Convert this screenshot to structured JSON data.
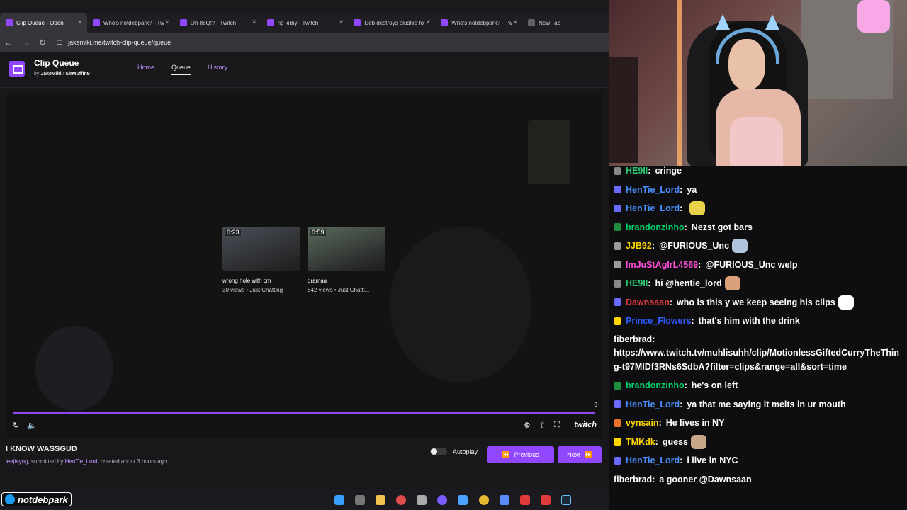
{
  "browser": {
    "tabs": [
      {
        "label": "Clip Queue - Open",
        "active": true,
        "fav_color": "#9147ff"
      },
      {
        "label": "Who's notdebpark? - Tw",
        "active": false,
        "fav_color": "#9147ff"
      },
      {
        "label": "Oh 88Q!? - Twitch",
        "active": false,
        "fav_color": "#9147ff"
      },
      {
        "label": "rip kirby - Twitch",
        "active": false,
        "fav_color": "#9147ff"
      },
      {
        "label": "Deb destroys plushie fo",
        "active": false,
        "fav_color": "#9147ff"
      },
      {
        "label": "Who's notdebpark? - Tw",
        "active": false,
        "fav_color": "#9147ff"
      },
      {
        "label": "New Tab",
        "active": false,
        "fav_color": "#5f6368"
      }
    ],
    "url": "jakemiki.me/twitch-clip-queue/queue"
  },
  "app": {
    "title": "Clip Queue",
    "by": "by",
    "author1": "JakeMiki",
    "sep": "/",
    "author2": "SirMuffin9",
    "nav": [
      {
        "label": "Home",
        "active": false
      },
      {
        "label": "Queue",
        "active": true
      },
      {
        "label": "History",
        "active": false
      }
    ]
  },
  "player": {
    "queue_count": "0",
    "brand": "twitch",
    "progress_fraction": 1.0,
    "clips": [
      {
        "duration": "0:23",
        "title": "wrong hole with cm",
        "meta": "30 views • Just Chatting",
        "thumb_color": "#4a4f58"
      },
      {
        "duration": "0:59",
        "title": "dramaa",
        "meta": "842 views • Just Chatti...",
        "thumb_color": "#5b6b5e"
      }
    ]
  },
  "current_clip": {
    "title": "I KNOW WASSGUD",
    "channel": "leejieyng",
    "submitted_text": ", submitted by",
    "submitter": "HenTie_Lord",
    "created": ", created about 3 hours ago",
    "autoplay_label": "Autoplay",
    "previous_label": "Previous",
    "next_label": "Next"
  },
  "overlay": {
    "handle": "notdebpark"
  },
  "chat": [
    {
      "name": "HE9II",
      "text": "cringe",
      "color": "#2ecc71",
      "badge": "#888888"
    },
    {
      "name": "HenTie_Lord",
      "text": "ya",
      "color": "#4a90ff",
      "badge": "#6a6aff"
    },
    {
      "name": "HenTie_Lord",
      "text": "",
      "color": "#4a90ff",
      "badge": "#6a6aff",
      "emote": "#e8d24a"
    },
    {
      "name": "brandonzinho",
      "text": "Nezst got bars",
      "color": "#00d26a",
      "badge": "#1e8f3e"
    },
    {
      "name": "JJB92",
      "text": "@FURIOUS_Unc",
      "color": "#ffd700",
      "badge": "#999999",
      "emote": "#b0c4de"
    },
    {
      "name": "ImJuStAgIrL4569",
      "text": "@FURIOUS_Unc welp",
      "color": "#ff4fd8",
      "badge": "#999999"
    },
    {
      "name": "HE9II",
      "text": "hi @hentie_lord",
      "color": "#2ecc71",
      "badge": "#888888",
      "emote": "#d9a27a"
    },
    {
      "name": "Dawnsaan",
      "text": "who is this y we keep seeing his clips",
      "color": "#e03a3a",
      "badge": "#6a6aff",
      "emote": "#ffffff"
    },
    {
      "name": "Prince_Flowers",
      "text": "that's him with the drink",
      "color": "#2f5bff",
      "badge": "#ffd700"
    },
    {
      "name": "fiberbrad",
      "text": "https://www.twitch.tv/muhlisuhh/clip/MotionlessGiftedCurryTheThing-t97MIDf3RNs6SdbA?filter=clips&range=all&sort=time",
      "color": "#ffffff",
      "badge": "",
      "wrap": true
    },
    {
      "name": "brandonzinho",
      "text": "he's on left",
      "color": "#00d26a",
      "badge": "#1e8f3e"
    },
    {
      "name": "HenTie_Lord",
      "text": "ya that me saying it melts in ur mouth",
      "color": "#4a90ff",
      "badge": "#6a6aff"
    },
    {
      "name": "vynsain",
      "text": "He lives in NY",
      "color": "#ffd700",
      "badge": "#e8732a"
    },
    {
      "name": "TMKdk",
      "text": "guess",
      "color": "#ffd700",
      "badge": "#ffd700",
      "emote": "#c8a888"
    },
    {
      "name": "HenTie_Lord",
      "text": "i live in NYC",
      "color": "#4a90ff",
      "badge": "#6a6aff"
    },
    {
      "name": "fiberbrad",
      "text": "a gooner @Dawnsaan",
      "color": "#ffffff",
      "badge": ""
    }
  ]
}
